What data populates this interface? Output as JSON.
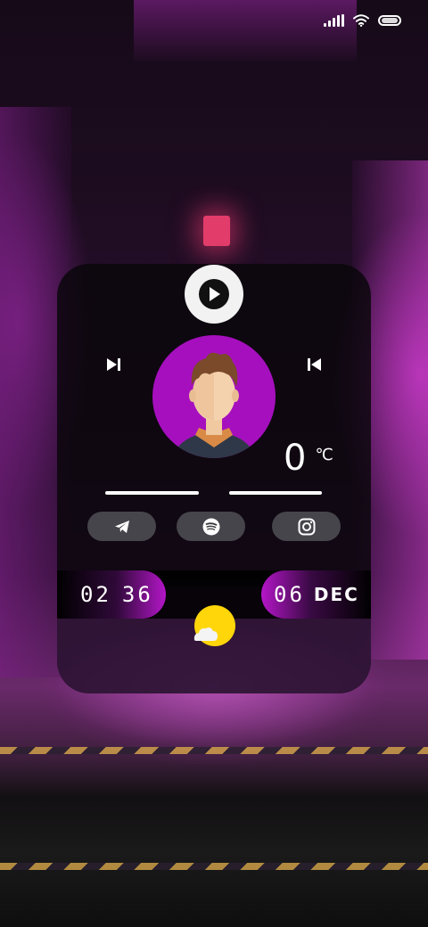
{
  "status_bar": {
    "icons": [
      "signal-icon",
      "wifi-icon",
      "battery-icon"
    ]
  },
  "music": {
    "play_icon": "play-icon",
    "next_icon": "skip-next-icon",
    "previous_icon": "skip-previous-icon",
    "progress": [
      1.0,
      1.0
    ]
  },
  "avatar": {
    "icon": "avatar-man-icon",
    "background": "#a60fbe"
  },
  "weather": {
    "temperature": "0",
    "unit": "℃",
    "icon": "sun-cloud-icon"
  },
  "social": [
    {
      "icon": "telegram-icon"
    },
    {
      "icon": "spotify-icon"
    },
    {
      "icon": "instagram-icon"
    }
  ],
  "clock": {
    "hours": "02",
    "minutes": "36"
  },
  "date": {
    "day": "06",
    "month": "DEC"
  },
  "colors": {
    "accent": "#b416c8",
    "sun": "#ffd60a",
    "card": "#08060a"
  }
}
